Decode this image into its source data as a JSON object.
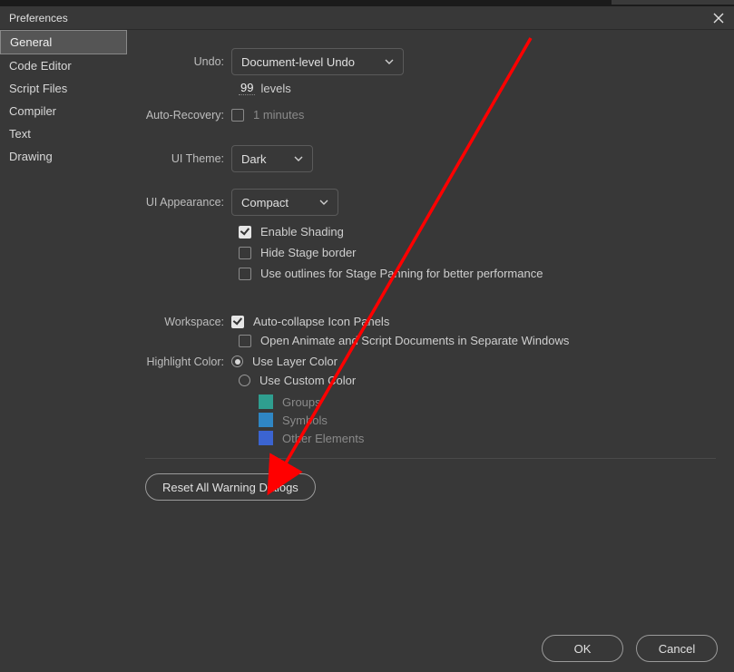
{
  "window": {
    "title": "Preferences"
  },
  "sidebar": {
    "items": [
      {
        "label": "General",
        "selected": true
      },
      {
        "label": "Code Editor"
      },
      {
        "label": "Script Files"
      },
      {
        "label": "Compiler"
      },
      {
        "label": "Text"
      },
      {
        "label": "Drawing"
      }
    ]
  },
  "labels": {
    "undo": "Undo:",
    "autoRecovery": "Auto-Recovery:",
    "uiTheme": "UI Theme:",
    "uiAppearance": "UI Appearance:",
    "workspace": "Workspace:",
    "highlightColor": "Highlight Color:"
  },
  "undo": {
    "selected": "Document-level Undo",
    "levelsValue": "99",
    "levelsLabel": "levels"
  },
  "autoRecovery": {
    "checked": false,
    "valueLabel": "1 minutes"
  },
  "uiTheme": {
    "selected": "Dark"
  },
  "uiAppearance": {
    "selected": "Compact"
  },
  "appearanceChecks": {
    "enableShading": {
      "label": "Enable Shading",
      "checked": true
    },
    "hideStageBorder": {
      "label": "Hide Stage border",
      "checked": false
    },
    "useOutlines": {
      "label": "Use outlines for Stage Panning for better performance",
      "checked": false
    }
  },
  "workspaceChecks": {
    "autoCollapse": {
      "label": "Auto-collapse Icon Panels",
      "checked": true
    },
    "separateWindows": {
      "label": "Open Animate and Script Documents in Separate Windows",
      "checked": false
    }
  },
  "highlight": {
    "useLayerColor": {
      "label": "Use Layer Color",
      "selected": true
    },
    "useCustomColor": {
      "label": "Use Custom Color",
      "selected": false
    },
    "swatches": {
      "groups": {
        "label": "Groups",
        "color": "#2f9e8f"
      },
      "symbols": {
        "label": "Symbols",
        "color": "#2f86c4"
      },
      "otherElements": {
        "label": "Other Elements",
        "color": "#3b64d1"
      }
    }
  },
  "buttons": {
    "resetWarnings": "Reset All Warning Dialogs",
    "ok": "OK",
    "cancel": "Cancel"
  }
}
